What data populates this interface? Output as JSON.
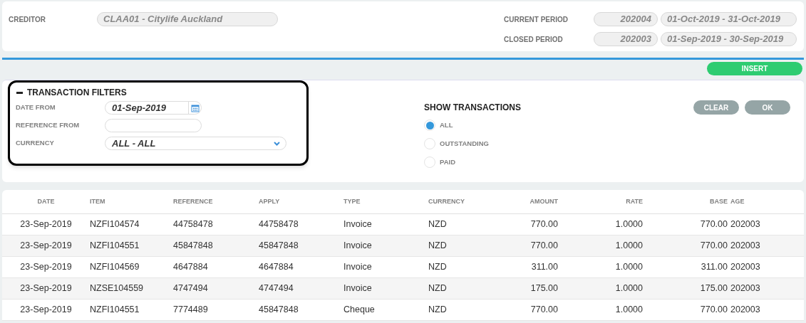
{
  "creditor": {
    "label": "CREDITOR",
    "value": "CLAA01 - Citylife Auckland"
  },
  "periods": [
    {
      "label": "CURRENT PERIOD",
      "period": "202004",
      "range": "01-Oct-2019 - 31-Oct-2019"
    },
    {
      "label": "CLOSED PERIOD",
      "period": "202003",
      "range": "01-Sep-2019 - 30-Sep-2019"
    }
  ],
  "insert_button": "INSERT",
  "filters": {
    "title": "TRANSACTION FILTERS",
    "expanded": true,
    "date_from": {
      "label": "DATE FROM",
      "value": "01-Sep-2019"
    },
    "reference_from": {
      "label": "REFERENCE FROM"
    },
    "currency": {
      "label": "CURRENCY",
      "value": "ALL - ALL"
    }
  },
  "show_transactions": {
    "title": "SHOW TRANSACTIONS",
    "options": [
      {
        "label": "ALL",
        "selected": true
      },
      {
        "label": "OUTSTANDING",
        "selected": false
      },
      {
        "label": "PAID",
        "selected": false
      }
    ]
  },
  "buttons": [
    "CLEAR",
    "OK"
  ],
  "table": {
    "columns": [
      "DATE",
      "ITEM",
      "REFERENCE",
      "APPLY",
      "TYPE",
      "CURRENCY",
      "AMOUNT",
      "RATE",
      "BASE",
      "AGE"
    ],
    "rows": [
      [
        "23-Sep-2019",
        "NZFI104574",
        "44758478",
        "44758478",
        "Invoice",
        "NZD",
        "770.00",
        "1.0000",
        "770.00",
        "202003"
      ],
      [
        "23-Sep-2019",
        "NZFI104551",
        "45847848",
        "45847848",
        "Invoice",
        "NZD",
        "770.00",
        "1.0000",
        "770.00",
        "202003"
      ],
      [
        "23-Sep-2019",
        "NZFI104569",
        "4647884",
        "4647884",
        "Invoice",
        "NZD",
        "311.00",
        "1.0000",
        "311.00",
        "202003"
      ],
      [
        "23-Sep-2019",
        "NZSE104559",
        "4747494",
        "4747494",
        "Invoice",
        "NZD",
        "175.00",
        "1.0000",
        "175.00",
        "202003"
      ],
      [
        "23-Sep-2019",
        "NZFI104551",
        "7774489",
        "45847848",
        "Cheque",
        "NZD",
        "770.00",
        "1.0000",
        "770.00",
        "202003"
      ]
    ]
  }
}
